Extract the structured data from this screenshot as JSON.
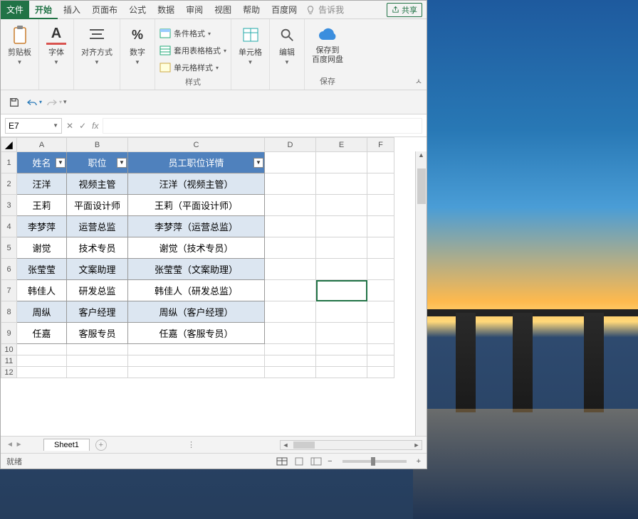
{
  "menu": {
    "file": "文件",
    "tabs": [
      "开始",
      "插入",
      "页面布",
      "公式",
      "数据",
      "审阅",
      "视图",
      "帮助",
      "百度网"
    ],
    "active_index": 0,
    "tell_me": "告诉我",
    "share": "共享"
  },
  "ribbon": {
    "clipboard": {
      "label": "剪贴板"
    },
    "font": {
      "label": "字体",
      "icon": "A"
    },
    "alignment": {
      "label": "对齐方式"
    },
    "number": {
      "label": "数字",
      "icon": "%"
    },
    "styles": {
      "label": "样式",
      "conditional": "条件格式",
      "table_format": "套用表格格式",
      "cell_style": "单元格样式"
    },
    "cells": {
      "label": "单元格"
    },
    "editing": {
      "label": "编辑"
    },
    "baidu": {
      "label": "保存",
      "btn": "保存到\n百度网盘"
    }
  },
  "name_box": "E7",
  "fx": "fx",
  "columns": [
    "A",
    "B",
    "C",
    "D",
    "E",
    "F"
  ],
  "headers": {
    "c1": "姓名",
    "c2": "职位",
    "c3": "员工职位详情"
  },
  "rows": [
    {
      "r": 1
    },
    {
      "r": 2,
      "a": "汪洋",
      "b": "视频主管",
      "c": "汪洋（视频主管）",
      "cls": "even"
    },
    {
      "r": 3,
      "a": "王莉",
      "b": "平面设计师",
      "c": "王莉（平面设计师）",
      "cls": "odd"
    },
    {
      "r": 4,
      "a": "李梦萍",
      "b": "运营总监",
      "c": "李梦萍（运营总监）",
      "cls": "even"
    },
    {
      "r": 5,
      "a": "谢觉",
      "b": "技术专员",
      "c": "谢觉（技术专员）",
      "cls": "odd"
    },
    {
      "r": 6,
      "a": "张莹莹",
      "b": "文案助理",
      "c": "张莹莹（文案助理）",
      "cls": "even"
    },
    {
      "r": 7,
      "a": "韩佳人",
      "b": "研发总监",
      "c": "韩佳人（研发总监）",
      "cls": "odd"
    },
    {
      "r": 8,
      "a": "周纵",
      "b": "客户经理",
      "c": "周纵（客户经理）",
      "cls": "even"
    },
    {
      "r": 9,
      "a": "任嘉",
      "b": "客服专员",
      "c": "任嘉（客服专员）",
      "cls": "odd"
    }
  ],
  "sheet_tab": "Sheet1",
  "status": "就绪"
}
